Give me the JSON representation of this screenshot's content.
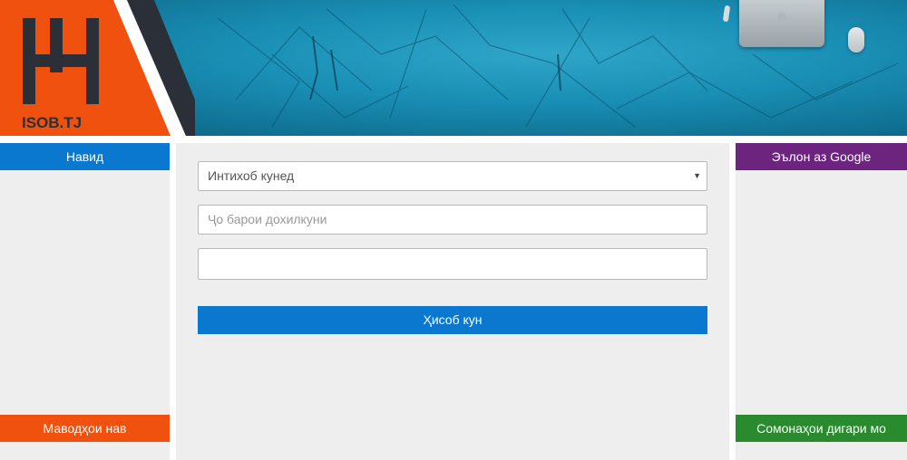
{
  "header": {
    "logo_text": "ISOB.TJ",
    "colors": {
      "orange": "#f0510e",
      "dark": "#2b3038",
      "sky": "#1a8fb5"
    }
  },
  "left_sidebar": {
    "top_title": "Навид",
    "bottom_title": "Маводҳои нав"
  },
  "right_sidebar": {
    "top_title": "Эълон аз Google",
    "bottom_title": "Сомонаҳои дигари мо"
  },
  "form": {
    "select": {
      "value": "Интихоб кунед",
      "arrow_icon": "dropdown-arrow-icon"
    },
    "input1": {
      "placeholder": "Ҷо барои дохилкуни"
    },
    "input2": {
      "value": ""
    },
    "submit_label": "Ҳисоб кун"
  },
  "colors": {
    "blue": "#0b78d0",
    "orange": "#f0510e",
    "purple": "#6d247f",
    "green": "#2a8a2e",
    "panel": "#eeeeee"
  }
}
